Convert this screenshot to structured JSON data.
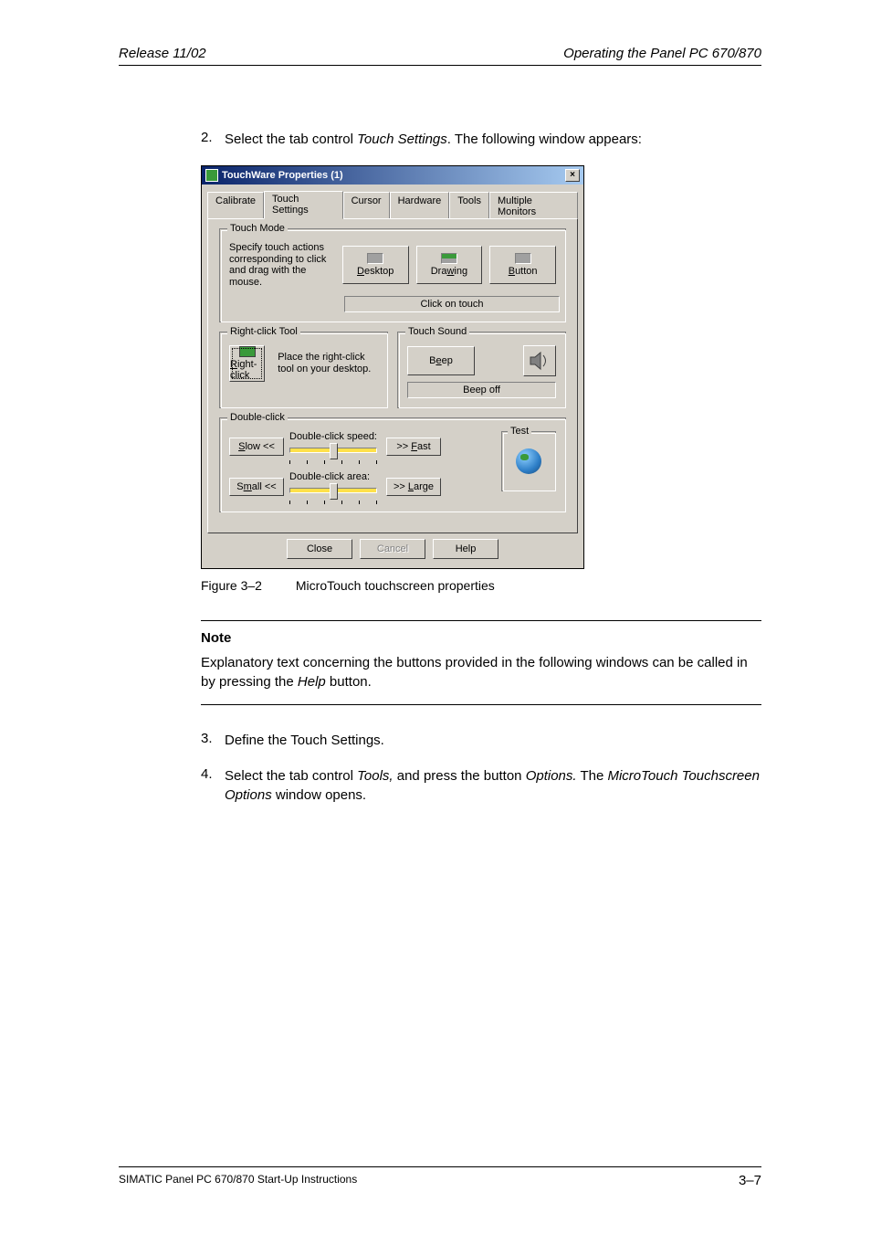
{
  "header": {
    "left": "Release 11/02",
    "right": "Operating the Panel PC 670/870"
  },
  "steps": {
    "s2": {
      "num": "2.",
      "pre": "Select the tab control ",
      "em1": "Touch Settings",
      "post": ". The following window appears:"
    },
    "s3": {
      "num": "3.",
      "text": "Define the Touch Settings."
    },
    "s4": {
      "num": "4.",
      "pre": "Select the tab control ",
      "em1": "Tools,",
      "mid": " and press the button ",
      "em2": "Options.",
      "mid2": " The ",
      "em3": "MicroTouch Touchscreen Options",
      "post": " window opens."
    }
  },
  "dialog": {
    "title": "TouchWare Properties (1)",
    "close": "×",
    "tabs": [
      "Calibrate",
      "Touch Settings",
      "Cursor",
      "Hardware",
      "Tools",
      "Multiple Monitors"
    ],
    "touchmode": {
      "legend": "Touch Mode",
      "desc": "Specify touch actions corresponding to click and drag with the mouse.",
      "desktop": "Desktop",
      "drawing": "Drawing",
      "button": "Button",
      "status": "Click on touch"
    },
    "rightclick": {
      "legend": "Right-click Tool",
      "btn": "Right-click",
      "desc": "Place the right-click tool on your desktop."
    },
    "touchsound": {
      "legend": "Touch Sound",
      "btn": "Beep",
      "status": "Beep off"
    },
    "doubleclick": {
      "legend": "Double-click",
      "slow": "Slow <<",
      "speed": "Double-click speed:",
      "fast": ">> Fast",
      "small": "Small <<",
      "area": "Double-click area:",
      "large": ">> Large",
      "test": "Test"
    },
    "buttons": {
      "close": "Close",
      "cancel": "Cancel",
      "help": "Help"
    }
  },
  "figure": {
    "label": "Figure 3–2",
    "caption": "MicroTouch touchscreen properties"
  },
  "note": {
    "title": "Note",
    "body_pre": "Explanatory text concerning the buttons provided in the following windows can be called in by pressing the ",
    "body_em": "Help",
    "body_post": " button."
  },
  "footer": {
    "left": "SIMATIC Panel PC 670/870 Start-Up Instructions",
    "right": "3–7"
  }
}
